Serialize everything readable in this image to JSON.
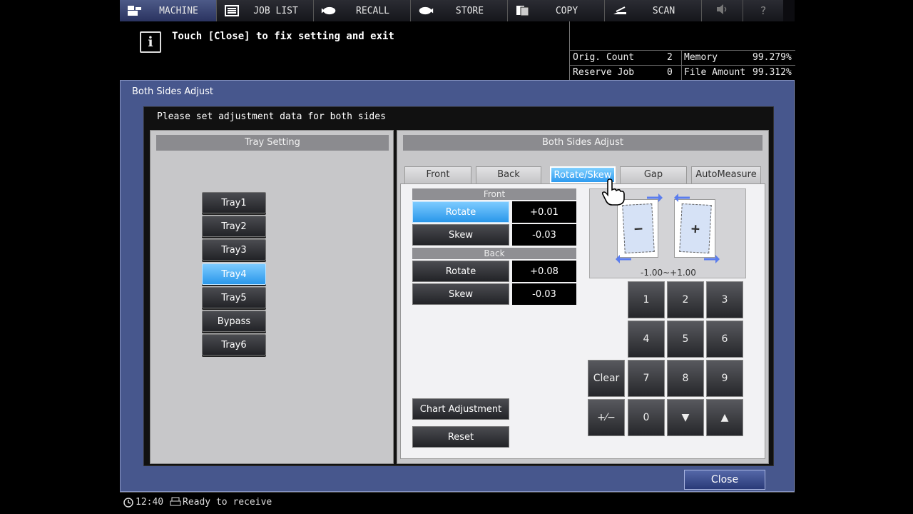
{
  "nav": {
    "tabs": [
      {
        "label": "MACHINE",
        "icon": "machine-icon",
        "active": true
      },
      {
        "label": "JOB LIST",
        "icon": "list-icon",
        "active": false
      },
      {
        "label": "RECALL",
        "icon": "recall-icon",
        "active": false
      },
      {
        "label": "STORE",
        "icon": "store-icon",
        "active": false
      },
      {
        "label": "COPY",
        "icon": "copy-icon",
        "active": false
      },
      {
        "label": "SCAN",
        "icon": "scan-icon",
        "active": false
      }
    ],
    "volume_icon": "speaker-icon",
    "help_label": "?"
  },
  "message": {
    "icon": "info-icon",
    "icon_glyph": "i",
    "text": "Touch [Close] to fix setting and exit"
  },
  "counters": {
    "orig_count_label": "Orig. Count",
    "orig_count_value": "2",
    "memory_label": "Memory",
    "memory_value": "99.279%",
    "reserve_job_label": "Reserve Job",
    "reserve_job_value": "0",
    "file_amount_label": "File Amount",
    "file_amount_value": "99.312%"
  },
  "dialog": {
    "title": "Both Sides Adjust",
    "instruction": "Please set adjustment data for both sides",
    "left_panel_title": "Tray Setting",
    "right_panel_title": "Both Sides Adjust",
    "trays": [
      {
        "label": "Tray1",
        "selected": false
      },
      {
        "label": "Tray2",
        "selected": false
      },
      {
        "label": "Tray3",
        "selected": false
      },
      {
        "label": "Tray4",
        "selected": true
      },
      {
        "label": "Tray5",
        "selected": false
      },
      {
        "label": "Bypass",
        "selected": false
      },
      {
        "label": "Tray6",
        "selected": false
      }
    ],
    "tabs": [
      {
        "label": "Front",
        "selected": false
      },
      {
        "label": "Back",
        "selected": false
      },
      {
        "label": "Rotate/Skew",
        "selected": true
      },
      {
        "label": "Gap",
        "selected": false
      },
      {
        "label": "AutoMeasure",
        "selected": false
      }
    ],
    "front": {
      "heading": "Front",
      "rotate_label": "Rotate",
      "rotate_value": "+0.01",
      "skew_label": "Skew",
      "skew_value": "-0.03"
    },
    "back": {
      "heading": "Back",
      "rotate_label": "Rotate",
      "rotate_value": "+0.08",
      "skew_label": "Skew",
      "skew_value": "-0.03"
    },
    "diagram": {
      "minus_label": "−",
      "plus_label": "+",
      "range": "-1.00~+1.00"
    },
    "keypad": {
      "k1": "1",
      "k2": "2",
      "k3": "3",
      "k4": "4",
      "k5": "5",
      "k6": "6",
      "clear": "Clear",
      "k7": "7",
      "k8": "8",
      "k9": "9",
      "plusminus": "+⁄−",
      "k0": "0",
      "down": "▼",
      "up": "▲"
    },
    "chart_adjustment_label": "Chart Adjustment",
    "reset_label": "Reset",
    "close_label": "Close"
  },
  "status": {
    "time": "12:40",
    "text": "Ready to receive",
    "clock_icon": "clock-icon",
    "printer_icon": "printer-icon"
  },
  "colors": {
    "dialog_bg": "#47578d",
    "selected_blue": "#2a97ea",
    "panel_gray": "#c7c7c9"
  }
}
